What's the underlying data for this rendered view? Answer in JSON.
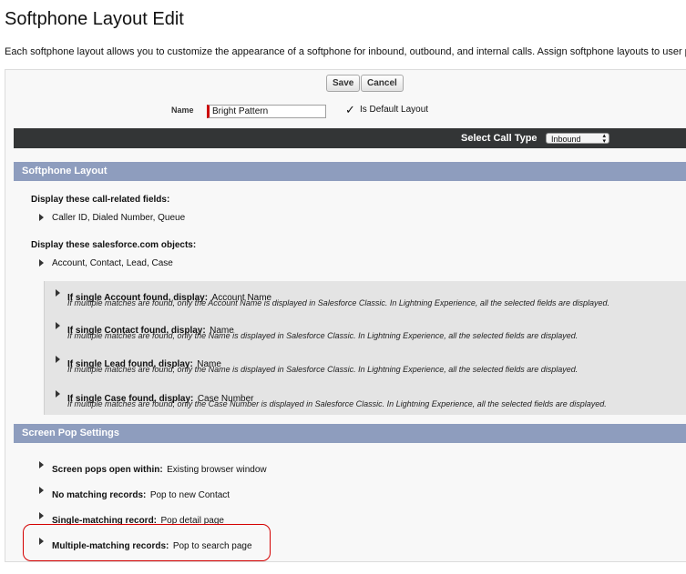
{
  "page": {
    "title": "Softphone Layout Edit",
    "description": "Each softphone layout allows you to customize the appearance of a softphone for inbound, outbound, and internal calls. Assign softphone layouts to user p"
  },
  "toolbar": {
    "save_label": "Save",
    "cancel_label": "Cancel"
  },
  "form": {
    "name_label": "Name",
    "name_value": "Bright Pattern",
    "default_checked_glyph": "✓",
    "default_label": "Is Default Layout"
  },
  "call_type": {
    "label": "Select Call Type",
    "selected": "Inbound",
    "arrow_glyph": "▲▼"
  },
  "softphone_layout": {
    "heading": "Softphone Layout",
    "call_fields_label": "Display these call-related fields:",
    "call_fields_value": "Caller ID, Dialed Number, Queue",
    "objects_label": "Display these salesforce.com objects:",
    "objects_value": "Account, Contact, Lead, Case",
    "details": [
      {
        "label": "If single Account found, display:",
        "value": "Account Name",
        "note": "If multiple matches are found, only the Account Name is displayed in Salesforce Classic. In Lightning Experience, all the selected fields are displayed."
      },
      {
        "label": "If single Contact found, display:",
        "value": "Name",
        "note": "If multiple matches are found, only the Name is displayed in Salesforce Classic. In Lightning Experience, all the selected fields are displayed."
      },
      {
        "label": "If single Lead found, display:",
        "value": "Name",
        "note": "If multiple matches are found, only the Name is displayed in Salesforce Classic. In Lightning Experience, all the selected fields are displayed."
      },
      {
        "label": "If single Case found, display:",
        "value": "Case Number",
        "note": "If multiple matches are found, only the Case Number is displayed in Salesforce Classic. In Lightning Experience, all the selected fields are displayed."
      }
    ]
  },
  "screen_pop": {
    "heading": "Screen Pop Settings",
    "items": [
      {
        "label": "Screen pops open within:",
        "value": "Existing browser window"
      },
      {
        "label": "No matching records:",
        "value": "Pop to new Contact"
      },
      {
        "label": "Single-matching record:",
        "value": "Pop detail page"
      },
      {
        "label": "Multiple-matching records:",
        "value": "Pop to search page"
      }
    ]
  },
  "colors": {
    "section_bar": "#8e9dbe",
    "dark_bar": "#333536",
    "highlight": "#d40000",
    "required": "#cc0000"
  }
}
